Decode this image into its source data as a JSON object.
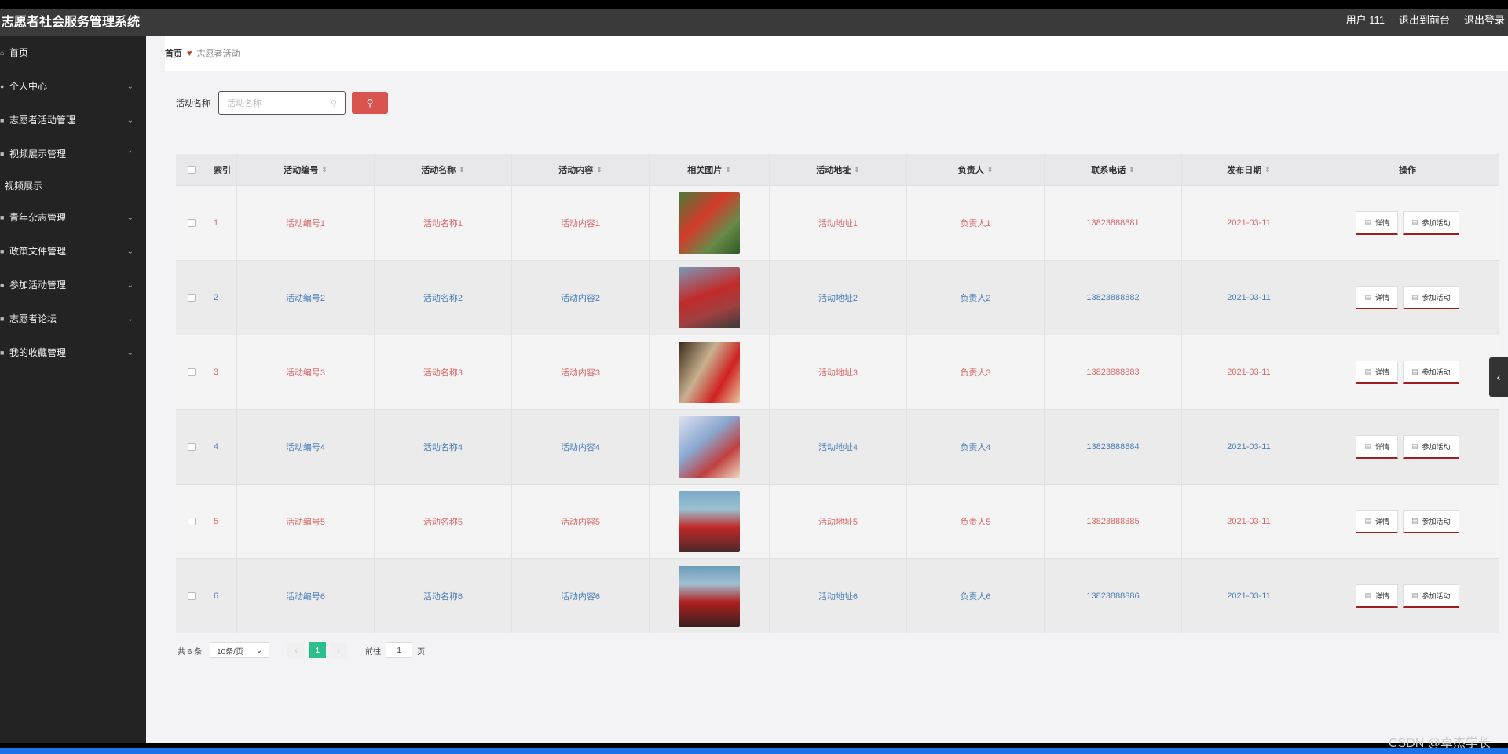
{
  "header": {
    "title": "志愿者社会服务管理系统",
    "user": "用户 111",
    "front": "退出到前台",
    "logout": "退出登录"
  },
  "sidebar": {
    "items": [
      {
        "label": "首页",
        "chev": ""
      },
      {
        "label": "个人中心",
        "chev": "⌄"
      },
      {
        "label": "志愿者活动管理",
        "chev": "⌄"
      },
      {
        "label": "视频展示管理",
        "chev": "⌃"
      }
    ],
    "sub": "视频展示",
    "items2": [
      {
        "label": "青年杂志管理",
        "chev": "⌄"
      },
      {
        "label": "政策文件管理",
        "chev": "⌄"
      },
      {
        "label": "参加活动管理",
        "chev": "⌄"
      },
      {
        "label": "志愿者论坛",
        "chev": "⌄"
      },
      {
        "label": "我的收藏管理",
        "chev": "⌄"
      }
    ]
  },
  "breadcrumb": {
    "home": "首页",
    "current": "志愿者活动"
  },
  "search": {
    "label": "活动名称",
    "placeholder": "活动名称"
  },
  "table": {
    "headers": {
      "idx": "索引",
      "code": "活动编号",
      "name": "活动名称",
      "content": "活动内容",
      "img": "相关图片",
      "addr": "活动地址",
      "owner": "负责人",
      "phone": "联系电话",
      "date": "发布日期",
      "op": "操作"
    },
    "rows": [
      {
        "idx": "1",
        "code": "活动编号1",
        "name": "活动名称1",
        "content": "活动内容1",
        "addr": "活动地址1",
        "owner": "负责人1",
        "phone": "13823888881",
        "date": "2021-03-11"
      },
      {
        "idx": "2",
        "code": "活动编号2",
        "name": "活动名称2",
        "content": "活动内容2",
        "addr": "活动地址2",
        "owner": "负责人2",
        "phone": "13823888882",
        "date": "2021-03-11"
      },
      {
        "idx": "3",
        "code": "活动编号3",
        "name": "活动名称3",
        "content": "活动内容3",
        "addr": "活动地址3",
        "owner": "负责人3",
        "phone": "13823888883",
        "date": "2021-03-11"
      },
      {
        "idx": "4",
        "code": "活动编号4",
        "name": "活动名称4",
        "content": "活动内容4",
        "addr": "活动地址4",
        "owner": "负责人4",
        "phone": "13823888884",
        "date": "2021-03-11"
      },
      {
        "idx": "5",
        "code": "活动编号5",
        "name": "活动名称5",
        "content": "活动内容5",
        "addr": "活动地址5",
        "owner": "负责人5",
        "phone": "13823888885",
        "date": "2021-03-11"
      },
      {
        "idx": "6",
        "code": "活动编号6",
        "name": "活动名称6",
        "content": "活动内容6",
        "addr": "活动地址6",
        "owner": "负责人6",
        "phone": "13823888886",
        "date": "2021-03-11"
      }
    ],
    "detail_label": "详情",
    "join_label": "参加活动"
  },
  "pager": {
    "total": "共 6 条",
    "size": "10条/页",
    "current": "1",
    "goto": "前往",
    "goto_value": "1",
    "page_unit": "页"
  },
  "watermark": "CSDN @卓杰学长",
  "colors": {
    "accent": "#d9534f",
    "pager_active": "#2bbf8a",
    "red_text": "#d96a6a",
    "blue_text": "#4a7fb8"
  }
}
